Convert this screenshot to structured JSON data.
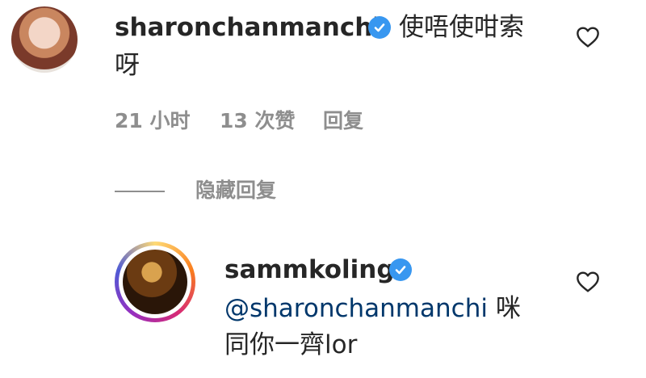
{
  "comment": {
    "username": "sharonchanmanchi",
    "text_line1": "使唔使咁索",
    "text_line2": "呀",
    "time": "21 小时",
    "likes": "13 次赞",
    "reply_label": "回复",
    "avatar_icon": "profile-avatar",
    "verified_icon": "verified-badge-icon",
    "like_icon": "heart-outline-icon"
  },
  "toggle_replies": {
    "label": "隐藏回复"
  },
  "reply": {
    "username": "sammkoling",
    "mention": "@sharonchanmanchi",
    "text_after_mention": " 咪",
    "text_line2": "同你一齊lor",
    "avatar_icon": "profile-avatar-story-ring",
    "verified_icon": "verified-badge-icon",
    "like_icon": "heart-outline-icon"
  },
  "colors": {
    "text": "#262626",
    "secondary": "#8e8e8e",
    "mention": "#00376b",
    "verified": "#3897f0"
  }
}
